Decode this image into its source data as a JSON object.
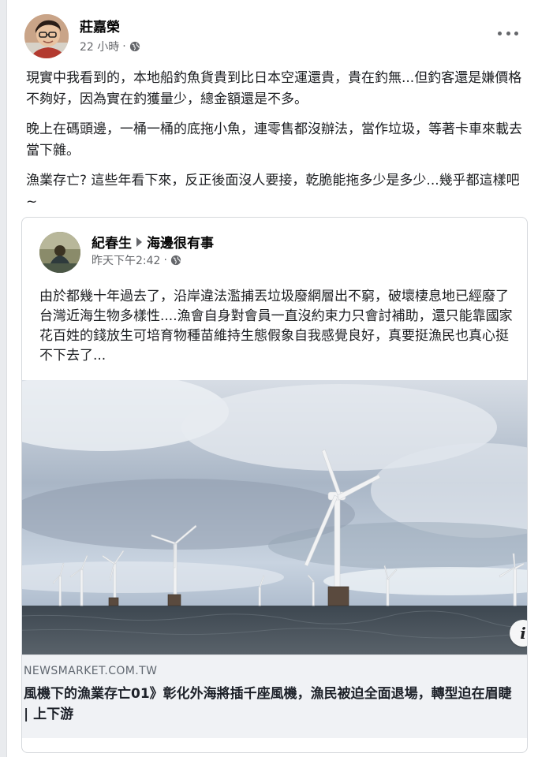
{
  "post": {
    "author": "莊嘉榮",
    "time": "22 小時",
    "separator": "·",
    "paragraphs": [
      "現實中我看到的，本地船釣魚貨貴到比日本空運還貴，貴在釣無...但釣客還是嫌價格不夠好，因為實在釣獲量少，總金額還是不多。",
      "晚上在碼頭邊，一桶一桶的底拖小魚，連零售都沒辦法，當作垃圾，等著卡車來載去當下雜。",
      "漁業存亡? 這些年看下來，反正後面沒人要接，乾脆能拖多少是多少...幾乎都這樣吧~"
    ]
  },
  "shared_post": {
    "author": "紀春生",
    "group": "海邊很有事",
    "time": "昨天下午2:42",
    "separator": "·",
    "text": "由於都幾十年過去了，沿岸違法濫捕丟垃圾廢網層出不窮，破壞棲息地已經廢了台灣近海生物多樣性....漁會自身對會員一直沒約束力只會討補助，還只能靠國家花百姓的錢放生可培育物種苗維持生態假象自我感覺良好，真要挺漁民也真心挺不下去了...",
    "link": {
      "domain": "NEWSMARKET.COM.TW",
      "title": "風機下的漁業存亡01》彰化外海將插千座風機，漁民被迫全面退場，轉型迫在眉睫 | 上下游",
      "info_label": "i"
    }
  },
  "colors": {
    "background": "#e9ebee",
    "card": "#ffffff",
    "meta_text": "#65676b",
    "link_meta_bg": "#f0f2f5"
  },
  "icons": [
    "more-options-icon",
    "globe-icon",
    "caret-right-icon",
    "info-icon"
  ]
}
